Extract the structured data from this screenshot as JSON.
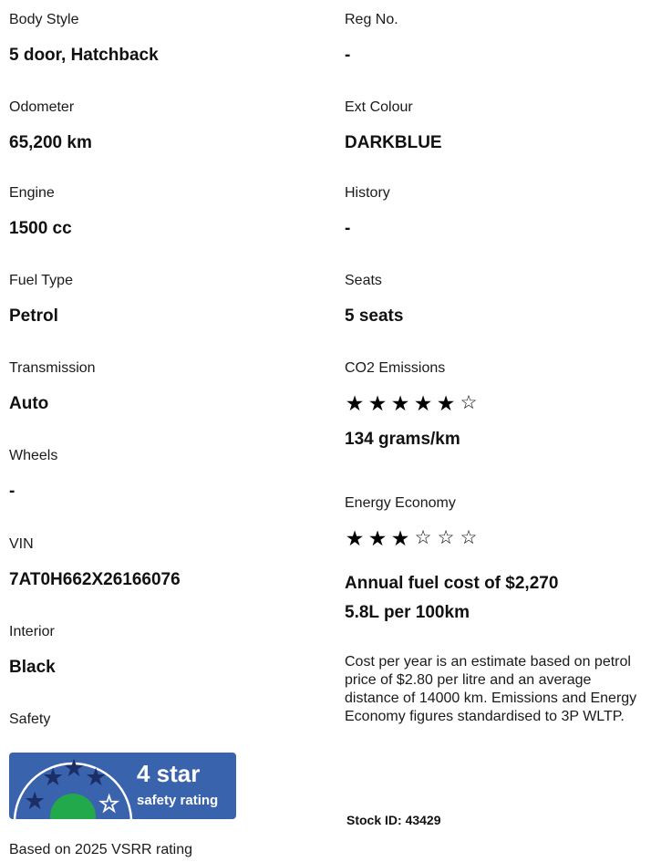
{
  "left_specs": [
    {
      "label": "Body Style",
      "value": "5 door, Hatchback"
    },
    {
      "label": "Odometer",
      "value": "65,200 km"
    },
    {
      "label": "Engine",
      "value": "1500 cc"
    },
    {
      "label": "Fuel Type",
      "value": "Petrol"
    },
    {
      "label": "Transmission",
      "value": "Auto"
    },
    {
      "label": "Wheels",
      "value": "-"
    },
    {
      "label": "VIN",
      "value": "7AT0H662X26166076"
    },
    {
      "label": "Interior",
      "value": "Black"
    }
  ],
  "right_specs": [
    {
      "label": "Reg No.",
      "value": "-"
    },
    {
      "label": "Ext Colour",
      "value": "DARKBLUE"
    },
    {
      "label": "History",
      "value": "-"
    },
    {
      "label": "Seats",
      "value": "5 seats"
    }
  ],
  "safety": {
    "label": "Safety",
    "badge_big": "4 star",
    "badge_small": "safety rating",
    "stars_rating": 4,
    "stars_total": 5,
    "badge_color": "#3a63ad",
    "footnote": "Based on 2025 VSRR rating"
  },
  "co2": {
    "label": "CO2 Emissions",
    "rating": 5,
    "total": 6,
    "value": "134 grams/km"
  },
  "energy": {
    "label": "Energy Economy",
    "rating": 3,
    "total": 6,
    "annual_cost": "Annual fuel cost of $2,270",
    "consumption": "5.8L per 100km",
    "note": "Cost per year is an estimate based on petrol price of  $2.80 per litre and an average distance of 14000 km. Emissions and Energy Economy figures standardised to 3P WLTP."
  },
  "stock": {
    "text": "Stock ID: 43429"
  }
}
